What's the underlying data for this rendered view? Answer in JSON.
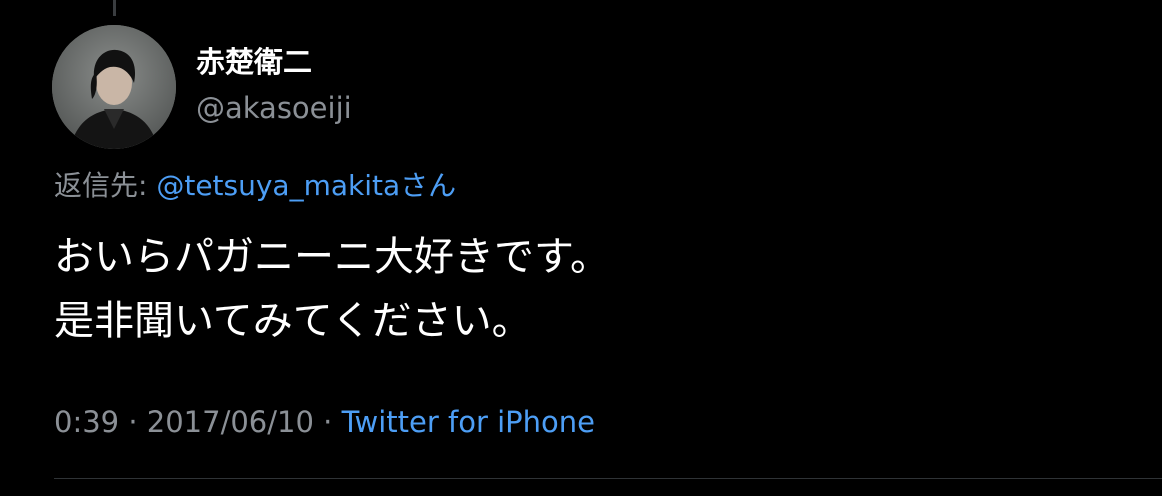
{
  "colors": {
    "background": "#000000",
    "primary_text": "#ffffff",
    "secondary_text": "#8b9096",
    "link": "#4d9ef5",
    "divider": "#2f3336"
  },
  "author": {
    "display_name": "赤楚衛二",
    "handle": "@akasoeiji",
    "avatar_icon": "user-avatar-photo"
  },
  "reply": {
    "prefix": "返信先: ",
    "mention": "@tetsuya_makita",
    "suffix": "さん"
  },
  "tweet": {
    "lines": [
      "おいらパガニーニ大好きです。",
      "是非聞いてみてください。"
    ]
  },
  "meta": {
    "time": "0:39",
    "separator": " · ",
    "date": "2017/06/10",
    "source": "Twitter for iPhone"
  }
}
